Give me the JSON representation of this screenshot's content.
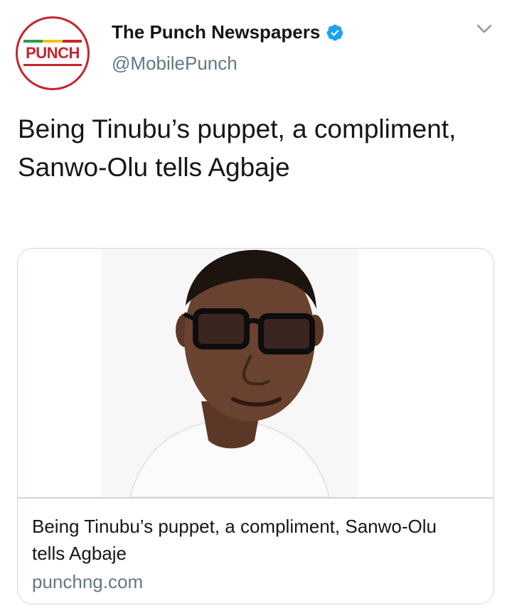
{
  "account": {
    "logo_text": "PUNCH",
    "display_name": "The Punch Newspapers",
    "handle": "@MobilePunch",
    "verified": true
  },
  "icons": {
    "verified": "verified-badge-icon",
    "menu": "chevron-down-icon"
  },
  "tweet": {
    "text": "Being Tinubu’s puppet, a compliment, Sanwo-Olu tells Agbaje"
  },
  "link_card": {
    "title": "Being Tinubu’s puppet, a compliment, Sanwo-Olu tells Agbaje",
    "domain": "punchng.com",
    "image": "portrait-photo"
  },
  "colors": {
    "brand_red": "#c6262e",
    "verified_blue": "#1da1f2",
    "text_primary": "#14171a",
    "text_secondary": "#657786",
    "border": "#ccd6dd"
  }
}
